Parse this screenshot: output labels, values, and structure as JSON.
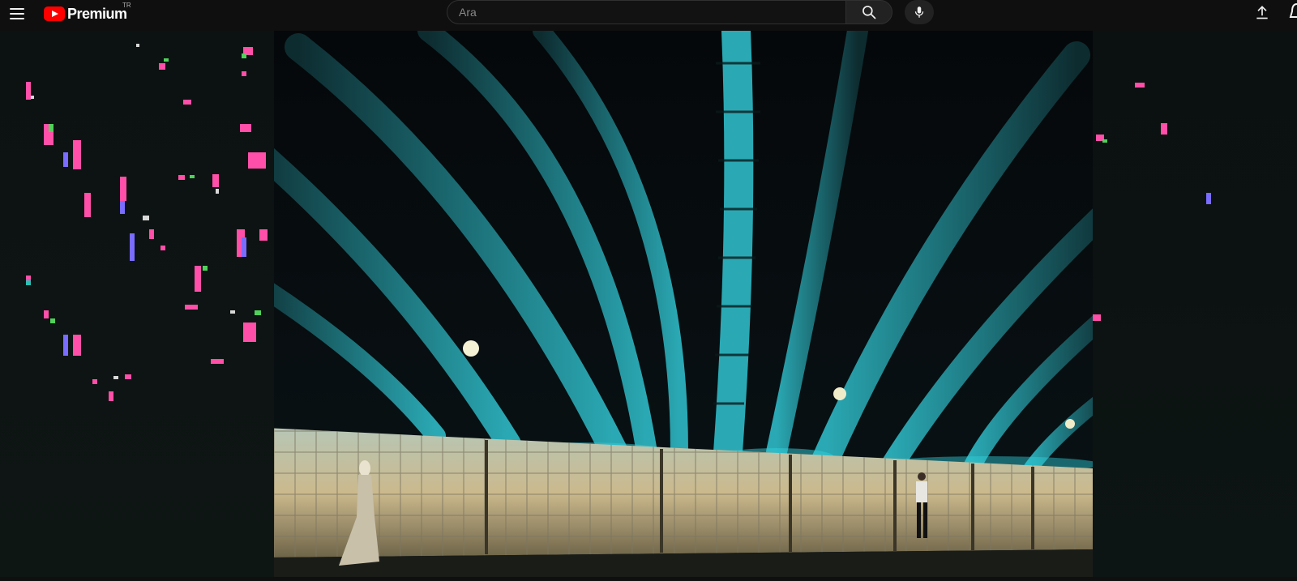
{
  "header": {
    "logo_text": "Premium",
    "country_code": "TR",
    "search": {
      "placeholder": "Ara",
      "value": ""
    }
  },
  "icons": {
    "menu": "hamburger-menu-icon",
    "search": "search-icon",
    "mic": "microphone-icon",
    "upload": "upload-icon",
    "notifications": "bell-icon"
  },
  "colors": {
    "background": "#0f0f0f",
    "brand_red": "#ff0000",
    "bridge_cyan": "#2fb3bd",
    "wall_light": "#d8c79a"
  },
  "video": {
    "scene": "steel-arch-tunnel"
  }
}
